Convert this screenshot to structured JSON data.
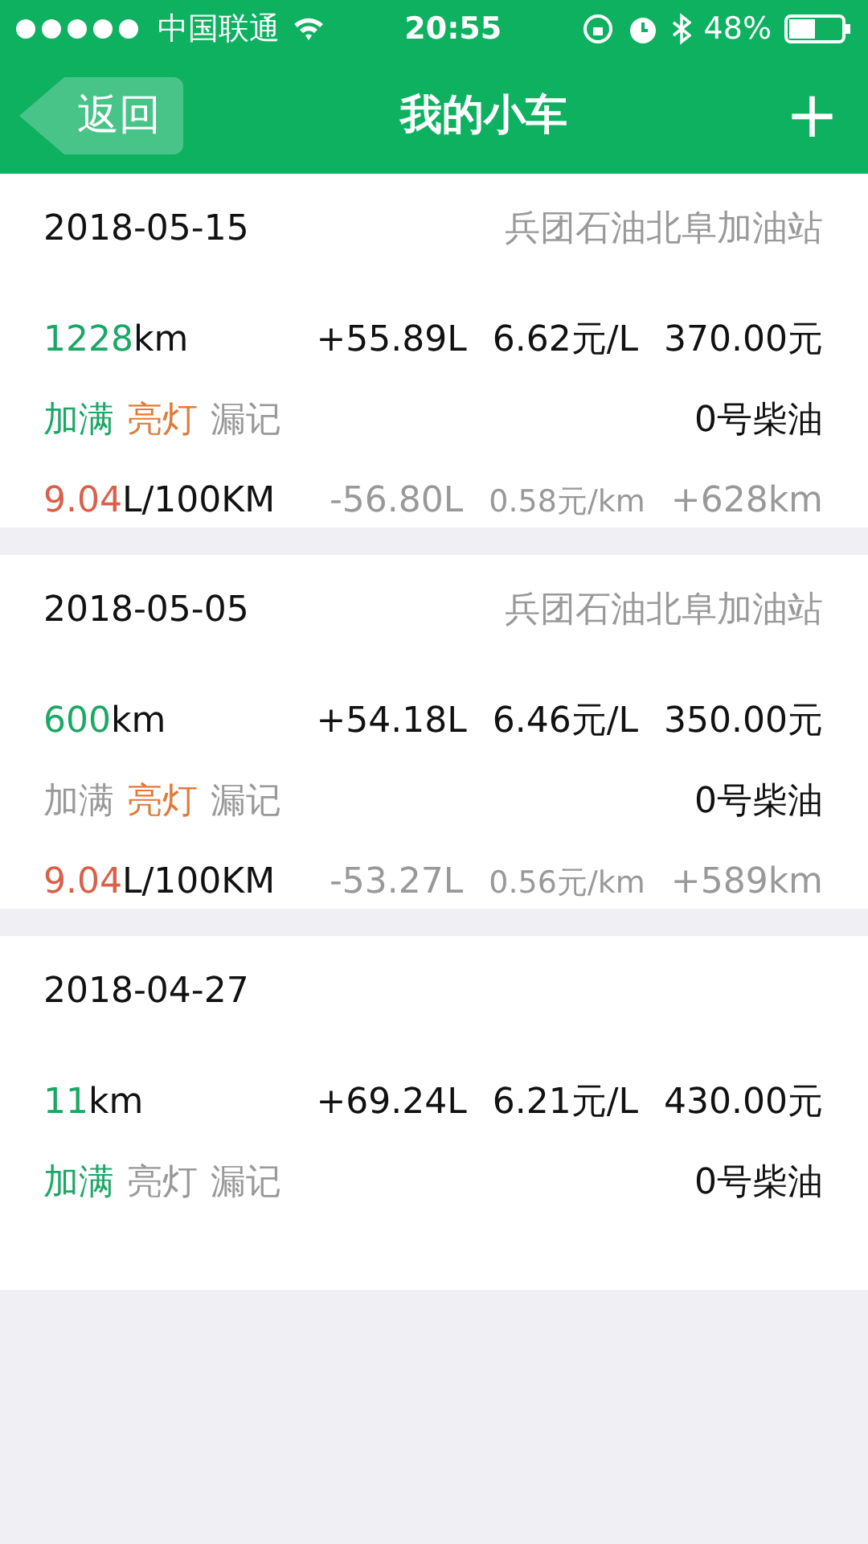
{
  "status_bar": {
    "carrier": "中国联通",
    "time": "20:55",
    "battery": "48%"
  },
  "nav": {
    "back": "返回",
    "title": "我的小车",
    "add": "+"
  },
  "records": [
    {
      "date": "2018-05-15",
      "station": "兵团石油北阜加油站",
      "odometer": "1228",
      "odometer_unit": "km",
      "fuel": "+55.89L",
      "price": "6.62元/L",
      "total": "370.00元",
      "flags": [
        {
          "label": "加满",
          "on": true,
          "kind": "full"
        },
        {
          "label": "亮灯",
          "on": true,
          "kind": "warning"
        },
        {
          "label": "漏记",
          "on": false,
          "kind": "missed"
        }
      ],
      "fuel_type": "0号柴油",
      "consumption": {
        "value": "9.04",
        "unit": "L/100KM",
        "used": "-56.80L",
        "cost": "0.58元/km",
        "distance": "+628km"
      }
    },
    {
      "date": "2018-05-05",
      "station": "兵团石油北阜加油站",
      "odometer": "600",
      "odometer_unit": "km",
      "fuel": "+54.18L",
      "price": "6.46元/L",
      "total": "350.00元",
      "flags": [
        {
          "label": "加满",
          "on": false,
          "kind": "full"
        },
        {
          "label": "亮灯",
          "on": true,
          "kind": "warning"
        },
        {
          "label": "漏记",
          "on": false,
          "kind": "missed"
        }
      ],
      "fuel_type": "0号柴油",
      "consumption": {
        "value": "9.04",
        "unit": "L/100KM",
        "used": "-53.27L",
        "cost": "0.56元/km",
        "distance": "+589km"
      }
    },
    {
      "date": "2018-04-27",
      "odometer": "11",
      "odometer_unit": "km",
      "fuel": "+69.24L",
      "price": "6.21元/L",
      "total": "430.00元",
      "flags": [
        {
          "label": "加满",
          "on": true,
          "kind": "full"
        },
        {
          "label": "亮灯",
          "on": false,
          "kind": "warning"
        },
        {
          "label": "漏记",
          "on": false,
          "kind": "missed"
        }
      ],
      "fuel_type": "0号柴油"
    }
  ]
}
